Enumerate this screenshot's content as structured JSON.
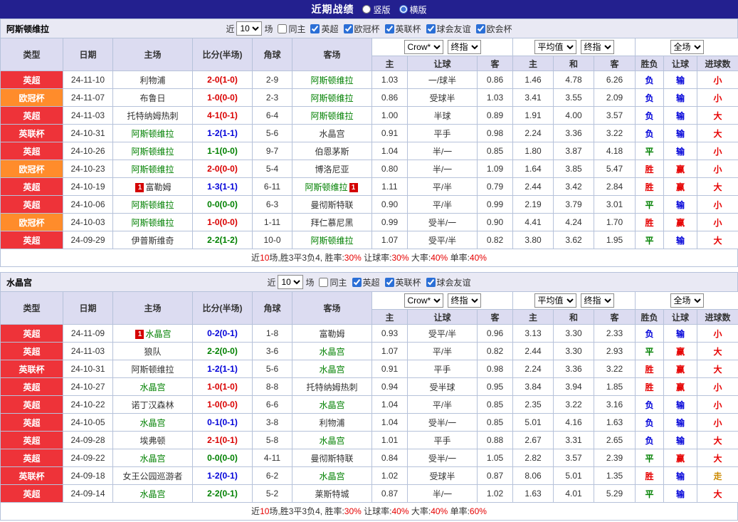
{
  "page": {
    "title": "近期战绩",
    "view_options": [
      {
        "label": "竖版",
        "selected": false
      },
      {
        "label": "横版",
        "selected": true
      }
    ]
  },
  "headers": {
    "type": "类型",
    "date": "日期",
    "home": "主场",
    "score": "比分(半场)",
    "corners": "角球",
    "away": "客场",
    "asia": [
      "主",
      "让球",
      "客"
    ],
    "euro": [
      "主",
      "和",
      "客"
    ],
    "result": [
      "胜负",
      "让球",
      "进球数"
    ]
  },
  "league_colors": {
    "英超": "#ee3339",
    "欧冠杯": "#ff8c2b",
    "英联杯": "#ee3339"
  },
  "score_colors": {
    "hw": "#d90000",
    "aw": "#0000d9",
    "d": "#008000"
  },
  "value_colors": {
    "胜": "#e60000",
    "平": "#008000",
    "负": "#0000d9",
    "赢": "#e60000",
    "输": "#0000d9",
    "大": "#e60000",
    "小": "#e60000",
    "走": "#cc8a00"
  },
  "sections": [
    {
      "team": "阿斯顿维拉",
      "filter": {
        "near_label": "近",
        "count": "10",
        "matches_label": "场",
        "same_home": {
          "label": "同主",
          "checked": false
        },
        "leagues": [
          {
            "label": "英超",
            "checked": true
          },
          {
            "label": "欧冠杯",
            "checked": true
          },
          {
            "label": "英联杯",
            "checked": true
          },
          {
            "label": "球会友谊",
            "checked": true
          },
          {
            "label": "欧会杯",
            "checked": true
          }
        ]
      },
      "controls": {
        "asia_source": "Crow*",
        "asia_type": "终指",
        "euro_source": "平均值",
        "euro_type": "终指",
        "scope": "全场"
      },
      "rows": [
        {
          "league": "英超",
          "date": "24-11-10",
          "home": "利物浦",
          "home_subject": false,
          "home_card": "",
          "score": "2-0(1-0)",
          "sc": "hw",
          "corners": "2-9",
          "away": "阿斯顿维拉",
          "away_subject": true,
          "away_card": "",
          "asia_home": "1.03",
          "handicap": "一/球半",
          "asia_away": "0.86",
          "euro_home": "1.46",
          "euro_draw": "4.78",
          "euro_away": "6.26",
          "wl": "负",
          "hc": "输",
          "ou": "小"
        },
        {
          "league": "欧冠杯",
          "date": "24-11-07",
          "home": "布鲁日",
          "home_subject": false,
          "home_card": "",
          "score": "1-0(0-0)",
          "sc": "hw",
          "corners": "2-3",
          "away": "阿斯顿维拉",
          "away_subject": true,
          "away_card": "",
          "asia_home": "0.86",
          "handicap": "受球半",
          "asia_away": "1.03",
          "euro_home": "3.41",
          "euro_draw": "3.55",
          "euro_away": "2.09",
          "wl": "负",
          "hc": "输",
          "ou": "小"
        },
        {
          "league": "英超",
          "date": "24-11-03",
          "home": "托特纳姆热刺",
          "home_subject": false,
          "home_card": "",
          "score": "4-1(0-1)",
          "sc": "hw",
          "corners": "6-4",
          "away": "阿斯顿维拉",
          "away_subject": true,
          "away_card": "",
          "asia_home": "1.00",
          "handicap": "半球",
          "asia_away": "0.89",
          "euro_home": "1.91",
          "euro_draw": "4.00",
          "euro_away": "3.57",
          "wl": "负",
          "hc": "输",
          "ou": "大"
        },
        {
          "league": "英联杯",
          "date": "24-10-31",
          "home": "阿斯顿维拉",
          "home_subject": true,
          "home_card": "",
          "score": "1-2(1-1)",
          "sc": "aw",
          "corners": "5-6",
          "away": "水晶宫",
          "away_subject": false,
          "away_card": "",
          "asia_home": "0.91",
          "handicap": "平手",
          "asia_away": "0.98",
          "euro_home": "2.24",
          "euro_draw": "3.36",
          "euro_away": "3.22",
          "wl": "负",
          "hc": "输",
          "ou": "大"
        },
        {
          "league": "英超",
          "date": "24-10-26",
          "home": "阿斯顿维拉",
          "home_subject": true,
          "home_card": "",
          "score": "1-1(0-0)",
          "sc": "d",
          "corners": "9-7",
          "away": "伯恩茅斯",
          "away_subject": false,
          "away_card": "",
          "asia_home": "1.04",
          "handicap": "半/一",
          "asia_away": "0.85",
          "euro_home": "1.80",
          "euro_draw": "3.87",
          "euro_away": "4.18",
          "wl": "平",
          "hc": "输",
          "ou": "小"
        },
        {
          "league": "欧冠杯",
          "date": "24-10-23",
          "home": "阿斯顿维拉",
          "home_subject": true,
          "home_card": "",
          "score": "2-0(0-0)",
          "sc": "hw",
          "corners": "5-4",
          "away": "博洛尼亚",
          "away_subject": false,
          "away_card": "",
          "asia_home": "0.80",
          "handicap": "半/一",
          "asia_away": "1.09",
          "euro_home": "1.64",
          "euro_draw": "3.85",
          "euro_away": "5.47",
          "wl": "胜",
          "hc": "赢",
          "ou": "小"
        },
        {
          "league": "英超",
          "date": "24-10-19",
          "home": "富勒姆",
          "home_subject": false,
          "home_card": "1",
          "score": "1-3(1-1)",
          "sc": "aw",
          "corners": "6-11",
          "away": "阿斯顿维拉",
          "away_subject": true,
          "away_card": "1",
          "asia_home": "1.11",
          "handicap": "平/半",
          "asia_away": "0.79",
          "euro_home": "2.44",
          "euro_draw": "3.42",
          "euro_away": "2.84",
          "wl": "胜",
          "hc": "赢",
          "ou": "大"
        },
        {
          "league": "英超",
          "date": "24-10-06",
          "home": "阿斯顿维拉",
          "home_subject": true,
          "home_card": "",
          "score": "0-0(0-0)",
          "sc": "d",
          "corners": "6-3",
          "away": "曼彻斯特联",
          "away_subject": false,
          "away_card": "",
          "asia_home": "0.90",
          "handicap": "平/半",
          "asia_away": "0.99",
          "euro_home": "2.19",
          "euro_draw": "3.79",
          "euro_away": "3.01",
          "wl": "平",
          "hc": "输",
          "ou": "小"
        },
        {
          "league": "欧冠杯",
          "date": "24-10-03",
          "home": "阿斯顿维拉",
          "home_subject": true,
          "home_card": "",
          "score": "1-0(0-0)",
          "sc": "hw",
          "corners": "1-11",
          "away": "拜仁慕尼黑",
          "away_subject": false,
          "away_card": "",
          "asia_home": "0.99",
          "handicap": "受半/一",
          "asia_away": "0.90",
          "euro_home": "4.41",
          "euro_draw": "4.24",
          "euro_away": "1.70",
          "wl": "胜",
          "hc": "赢",
          "ou": "小"
        },
        {
          "league": "英超",
          "date": "24-09-29",
          "home": "伊普斯维奇",
          "home_subject": false,
          "home_card": "",
          "score": "2-2(1-2)",
          "sc": "d",
          "corners": "10-0",
          "away": "阿斯顿维拉",
          "away_subject": true,
          "away_card": "",
          "asia_home": "1.07",
          "handicap": "受平/半",
          "asia_away": "0.82",
          "euro_home": "3.80",
          "euro_draw": "3.62",
          "euro_away": "1.95",
          "wl": "平",
          "hc": "输",
          "ou": "大"
        }
      ],
      "summary": [
        {
          "t": "近",
          "red": false
        },
        {
          "t": "10",
          "red": true
        },
        {
          "t": "场,胜3平3负4, ",
          "red": false
        },
        {
          "t": "胜率:",
          "red": false
        },
        {
          "t": "30%",
          "red": true
        },
        {
          "t": " 让球率:",
          "red": false
        },
        {
          "t": "30%",
          "red": true
        },
        {
          "t": " 大率:",
          "red": false
        },
        {
          "t": "40%",
          "red": true
        },
        {
          "t": " 单率:",
          "red": false
        },
        {
          "t": "40%",
          "red": true
        }
      ]
    },
    {
      "team": "水晶宫",
      "filter": {
        "near_label": "近",
        "count": "10",
        "matches_label": "场",
        "same_home": {
          "label": "同主",
          "checked": false
        },
        "leagues": [
          {
            "label": "英超",
            "checked": true
          },
          {
            "label": "英联杯",
            "checked": true
          },
          {
            "label": "球会友谊",
            "checked": true
          }
        ]
      },
      "controls": {
        "asia_source": "Crow*",
        "asia_type": "终指",
        "euro_source": "平均值",
        "euro_type": "终指",
        "scope": "全场"
      },
      "rows": [
        {
          "league": "英超",
          "date": "24-11-09",
          "home": "水晶宫",
          "home_subject": true,
          "home_card": "1",
          "score": "0-2(0-1)",
          "sc": "aw",
          "corners": "1-8",
          "away": "富勒姆",
          "away_subject": false,
          "away_card": "",
          "asia_home": "0.93",
          "handicap": "受平/半",
          "asia_away": "0.96",
          "euro_home": "3.13",
          "euro_draw": "3.30",
          "euro_away": "2.33",
          "wl": "负",
          "hc": "输",
          "ou": "小"
        },
        {
          "league": "英超",
          "date": "24-11-03",
          "home": "狼队",
          "home_subject": false,
          "home_card": "",
          "score": "2-2(0-0)",
          "sc": "d",
          "corners": "3-6",
          "away": "水晶宫",
          "away_subject": true,
          "away_card": "",
          "asia_home": "1.07",
          "handicap": "平/半",
          "asia_away": "0.82",
          "euro_home": "2.44",
          "euro_draw": "3.30",
          "euro_away": "2.93",
          "wl": "平",
          "hc": "赢",
          "ou": "大"
        },
        {
          "league": "英联杯",
          "date": "24-10-31",
          "home": "阿斯顿维拉",
          "home_subject": false,
          "home_card": "",
          "score": "1-2(1-1)",
          "sc": "aw",
          "corners": "5-6",
          "away": "水晶宫",
          "away_subject": true,
          "away_card": "",
          "asia_home": "0.91",
          "handicap": "平手",
          "asia_away": "0.98",
          "euro_home": "2.24",
          "euro_draw": "3.36",
          "euro_away": "3.22",
          "wl": "胜",
          "hc": "赢",
          "ou": "大"
        },
        {
          "league": "英超",
          "date": "24-10-27",
          "home": "水晶宫",
          "home_subject": true,
          "home_card": "",
          "score": "1-0(1-0)",
          "sc": "hw",
          "corners": "8-8",
          "away": "托特纳姆热刺",
          "away_subject": false,
          "away_card": "",
          "asia_home": "0.94",
          "handicap": "受半球",
          "asia_away": "0.95",
          "euro_home": "3.84",
          "euro_draw": "3.94",
          "euro_away": "1.85",
          "wl": "胜",
          "hc": "赢",
          "ou": "小"
        },
        {
          "league": "英超",
          "date": "24-10-22",
          "home": "诺丁汉森林",
          "home_subject": false,
          "home_card": "",
          "score": "1-0(0-0)",
          "sc": "hw",
          "corners": "6-6",
          "away": "水晶宫",
          "away_subject": true,
          "away_card": "",
          "asia_home": "1.04",
          "handicap": "平/半",
          "asia_away": "0.85",
          "euro_home": "2.35",
          "euro_draw": "3.22",
          "euro_away": "3.16",
          "wl": "负",
          "hc": "输",
          "ou": "小"
        },
        {
          "league": "英超",
          "date": "24-10-05",
          "home": "水晶宫",
          "home_subject": true,
          "home_card": "",
          "score": "0-1(0-1)",
          "sc": "aw",
          "corners": "3-8",
          "away": "利物浦",
          "away_subject": false,
          "away_card": "",
          "asia_home": "1.04",
          "handicap": "受半/一",
          "asia_away": "0.85",
          "euro_home": "5.01",
          "euro_draw": "4.16",
          "euro_away": "1.63",
          "wl": "负",
          "hc": "输",
          "ou": "小"
        },
        {
          "league": "英超",
          "date": "24-09-28",
          "home": "埃弗顿",
          "home_subject": false,
          "home_card": "",
          "score": "2-1(0-1)",
          "sc": "hw",
          "corners": "5-8",
          "away": "水晶宫",
          "away_subject": true,
          "away_card": "",
          "asia_home": "1.01",
          "handicap": "平手",
          "asia_away": "0.88",
          "euro_home": "2.67",
          "euro_draw": "3.31",
          "euro_away": "2.65",
          "wl": "负",
          "hc": "输",
          "ou": "大"
        },
        {
          "league": "英超",
          "date": "24-09-22",
          "home": "水晶宫",
          "home_subject": true,
          "home_card": "",
          "score": "0-0(0-0)",
          "sc": "d",
          "corners": "4-11",
          "away": "曼彻斯特联",
          "away_subject": false,
          "away_card": "",
          "asia_home": "0.84",
          "handicap": "受半/一",
          "asia_away": "1.05",
          "euro_home": "2.82",
          "euro_draw": "3.57",
          "euro_away": "2.39",
          "wl": "平",
          "hc": "赢",
          "ou": "大"
        },
        {
          "league": "英联杯",
          "date": "24-09-18",
          "home": "女王公园巡游者",
          "home_subject": false,
          "home_card": "",
          "score": "1-2(0-1)",
          "sc": "aw",
          "corners": "6-2",
          "away": "水晶宫",
          "away_subject": true,
          "away_card": "",
          "asia_home": "1.02",
          "handicap": "受球半",
          "asia_away": "0.87",
          "euro_home": "8.06",
          "euro_draw": "5.01",
          "euro_away": "1.35",
          "wl": "胜",
          "hc": "输",
          "ou": "走"
        },
        {
          "league": "英超",
          "date": "24-09-14",
          "home": "水晶宫",
          "home_subject": true,
          "home_card": "",
          "score": "2-2(0-1)",
          "sc": "d",
          "corners": "5-2",
          "away": "莱斯特城",
          "away_subject": false,
          "away_card": "",
          "asia_home": "0.87",
          "handicap": "半/一",
          "asia_away": "1.02",
          "euro_home": "1.63",
          "euro_draw": "4.01",
          "euro_away": "5.29",
          "wl": "平",
          "hc": "输",
          "ou": "大"
        }
      ],
      "summary": [
        {
          "t": "近",
          "red": false
        },
        {
          "t": "10",
          "red": true
        },
        {
          "t": "场,胜3平3负4, ",
          "red": false
        },
        {
          "t": "胜率:",
          "red": false
        },
        {
          "t": "30%",
          "red": true
        },
        {
          "t": " 让球率:",
          "red": false
        },
        {
          "t": "40%",
          "red": true
        },
        {
          "t": " 大率:",
          "red": false
        },
        {
          "t": "40%",
          "red": true
        },
        {
          "t": " 单率:",
          "red": false
        },
        {
          "t": "60%",
          "red": true
        }
      ]
    }
  ]
}
